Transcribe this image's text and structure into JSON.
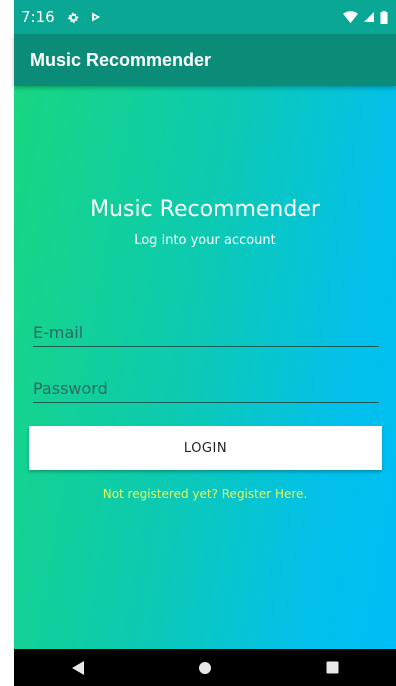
{
  "status_bar": {
    "time": "7:16",
    "icons_left": [
      "settings-icon",
      "play-icon"
    ],
    "icons_right": [
      "wifi-icon",
      "signal-icon",
      "battery-icon"
    ]
  },
  "app_bar": {
    "title": "Music Recommender"
  },
  "login": {
    "title": "Music Recommender",
    "subtitle": "Log into your account",
    "email_placeholder": "E-mail",
    "password_placeholder": "Password",
    "login_button_label": "LOGIN",
    "register_link": "Not registered yet? Register Here."
  },
  "nav_bar": {
    "icons": [
      "back-icon",
      "home-icon",
      "recents-icon"
    ]
  },
  "colors": {
    "status_bar": "#0aa795",
    "app_bar": "#0b8c78",
    "gradient_start": "#18d680",
    "gradient_end": "#00bef5",
    "register_link": "#e6f55a"
  }
}
